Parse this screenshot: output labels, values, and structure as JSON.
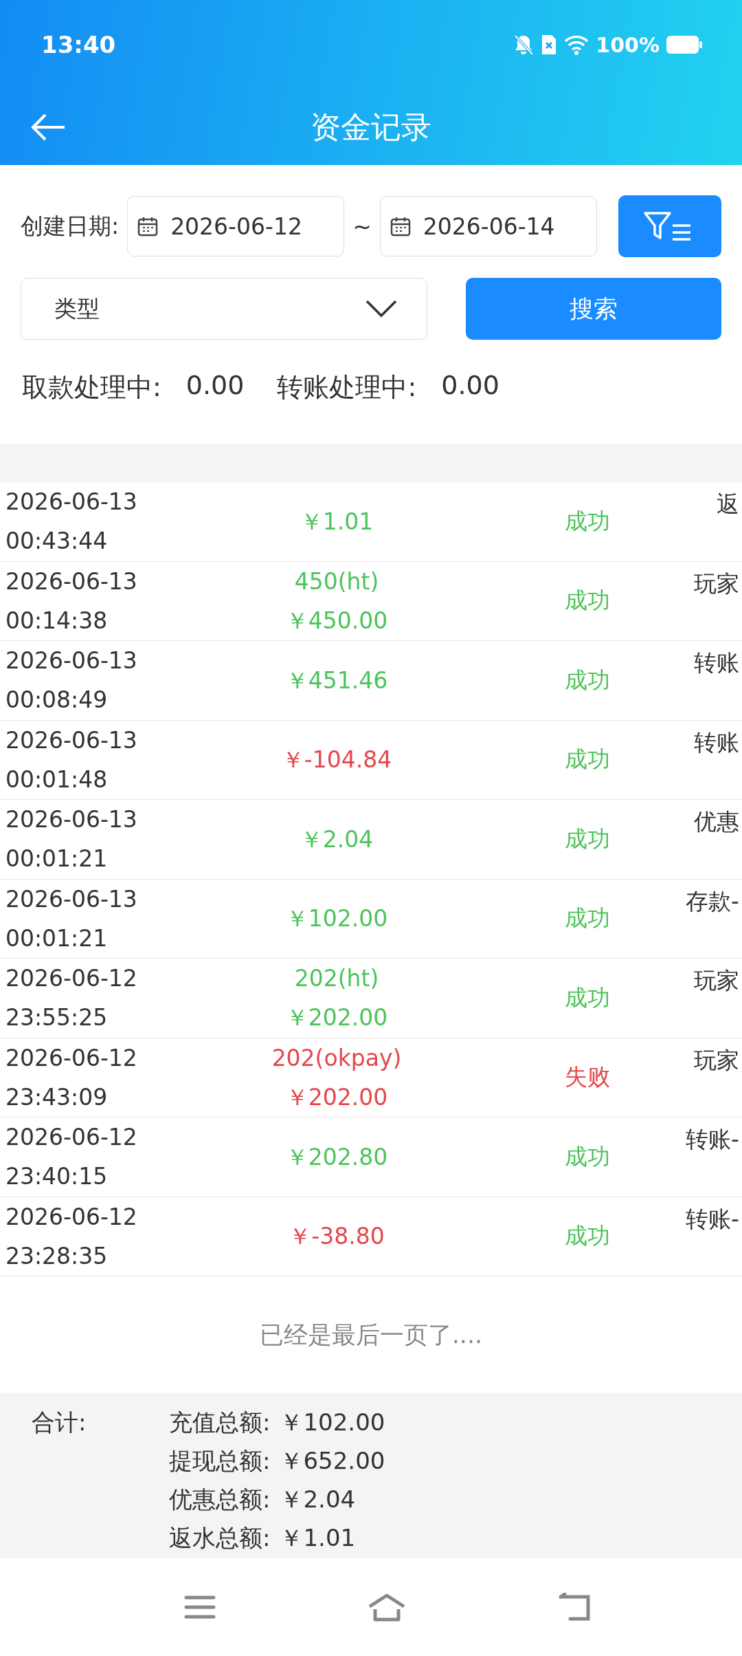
{
  "status_bar": {
    "time": "13:40",
    "battery": "100%"
  },
  "header": {
    "title": "资金记录"
  },
  "filters": {
    "date_label": "创建日期:",
    "start_date": "2026-06-12",
    "separator": "~",
    "end_date": "2026-06-14",
    "type_placeholder": "类型",
    "search_button": "搜索"
  },
  "summary": [
    {
      "label": "取款处理中:",
      "value": "0.00"
    },
    {
      "label": "转账处理中:",
      "value": "0.00"
    }
  ],
  "rows": [
    {
      "date": "2026-06-13",
      "time": "00:43:44",
      "amount_lines": [
        "￥1.01"
      ],
      "color": "#4cc45a",
      "status": "成功",
      "succeeded": true,
      "remark": "返"
    },
    {
      "date": "2026-06-13",
      "time": "00:14:38",
      "amount_lines": [
        "450(ht)",
        "￥450.00"
      ],
      "color": "#4cc45a",
      "status": "成功",
      "succeeded": true,
      "remark": "玩家"
    },
    {
      "date": "2026-06-13",
      "time": "00:08:49",
      "amount_lines": [
        "￥451.46"
      ],
      "color": "#4cc45a",
      "status": "成功",
      "succeeded": true,
      "remark": "转账"
    },
    {
      "date": "2026-06-13",
      "time": "00:01:48",
      "amount_lines": [
        "￥-104.84"
      ],
      "color": "#e5474b",
      "status": "成功",
      "succeeded": true,
      "remark": "转账"
    },
    {
      "date": "2026-06-13",
      "time": "00:01:21",
      "amount_lines": [
        "￥2.04"
      ],
      "color": "#4cc45a",
      "status": "成功",
      "succeeded": true,
      "remark": "优惠"
    },
    {
      "date": "2026-06-13",
      "time": "00:01:21",
      "amount_lines": [
        "￥102.00"
      ],
      "color": "#4cc45a",
      "status": "成功",
      "succeeded": true,
      "remark": "存款-"
    },
    {
      "date": "2026-06-12",
      "time": "23:55:25",
      "amount_lines": [
        "202(ht)",
        "￥202.00"
      ],
      "color": "#4cc45a",
      "status": "成功",
      "succeeded": true,
      "remark": "玩家"
    },
    {
      "date": "2026-06-12",
      "time": "23:43:09",
      "amount_lines": [
        "202(okpay)",
        "￥202.00"
      ],
      "color": "#e5474b",
      "status": "失败",
      "succeeded": false,
      "remark": "玩家"
    },
    {
      "date": "2026-06-12",
      "time": "23:40:15",
      "amount_lines": [
        "￥202.80"
      ],
      "color": "#4cc45a",
      "status": "成功",
      "succeeded": true,
      "remark": "转账-"
    },
    {
      "date": "2026-06-12",
      "time": "23:28:35",
      "amount_lines": [
        "￥-38.80"
      ],
      "color": "#e5474b",
      "status": "成功",
      "succeeded": true,
      "remark": "转账-"
    }
  ],
  "end_note": "已经是最后一页了....",
  "totals": {
    "label": "合计:",
    "items": [
      {
        "label": "充值总额:",
        "value": "￥102.00"
      },
      {
        "label": "提现总额:",
        "value": "￥652.00"
      },
      {
        "label": "优惠总额:",
        "value": "￥2.04"
      },
      {
        "label": "返水总额:",
        "value": "￥1.01"
      }
    ]
  }
}
